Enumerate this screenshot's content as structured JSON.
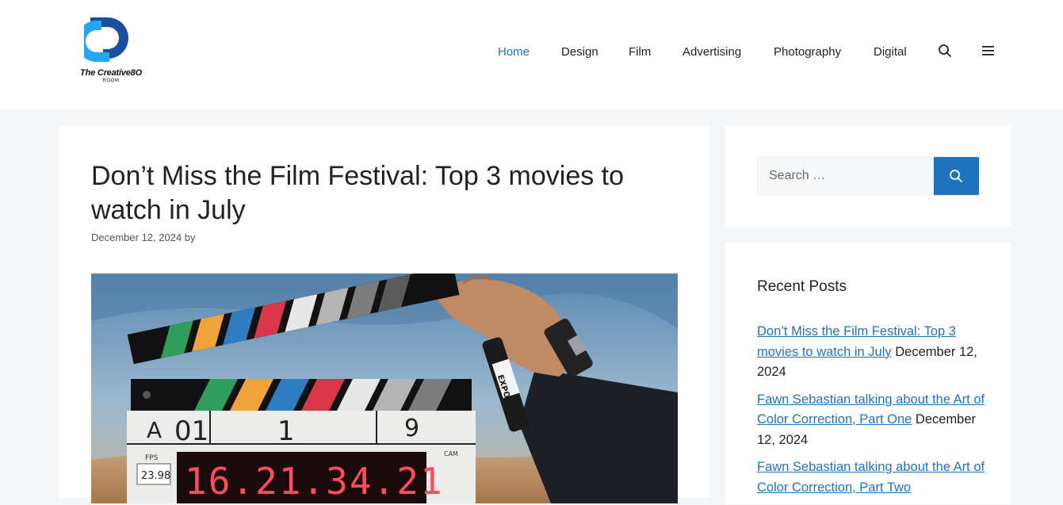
{
  "header": {
    "logo": {
      "title": "The Creative8O",
      "subtitle": "ROOM"
    },
    "nav": [
      {
        "label": "Home",
        "active": true
      },
      {
        "label": "Design"
      },
      {
        "label": "Film"
      },
      {
        "label": "Advertising"
      },
      {
        "label": "Photography"
      },
      {
        "label": "Digital"
      }
    ],
    "icons": [
      "search-icon",
      "menu-icon"
    ]
  },
  "article": {
    "title": "Don’t Miss the Film Festival: Top 3 movies to watch in July",
    "meta": "December 12, 2024 by",
    "clapper_readout": "16.21.34.21",
    "slate": {
      "roll": "A",
      "scene_no": "01",
      "scene": "1",
      "take": "9",
      "fps": "23.98",
      "marker_brand": "EXPO"
    }
  },
  "sidebar": {
    "search": {
      "placeholder": "Search …"
    },
    "recent": {
      "title": "Recent Posts",
      "posts": [
        {
          "link": "Don’t Miss the Film Festival: Top 3 movies to watch in July",
          "date": "December 12, 2024"
        },
        {
          "link": "Fawn Sebastian talking about the Art of Color Correction, Part One",
          "date": "December 12, 2024"
        },
        {
          "link": "Fawn Sebastian talking about the Art of Color Correction, Part Two",
          "date": ""
        }
      ]
    }
  },
  "colors": {
    "accent": "#1e73be",
    "background": "#f6f7f9",
    "card": "#ffffff",
    "logo_blue": "#1a8fe0"
  }
}
